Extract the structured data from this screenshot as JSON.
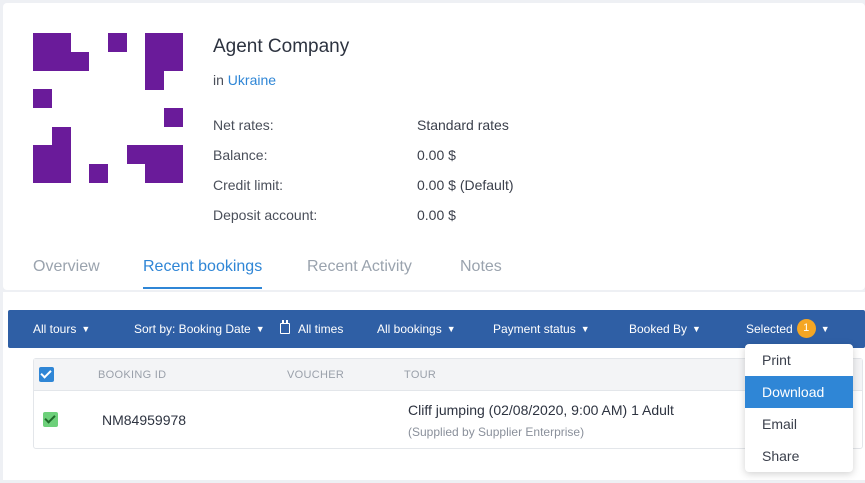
{
  "company": {
    "name": "Agent Company",
    "location_prefix": "in",
    "location": "Ukraine"
  },
  "info": [
    {
      "label": "Net rates:",
      "value": "Standard rates"
    },
    {
      "label": "Balance:",
      "value": "0.00 $"
    },
    {
      "label": "Credit limit:",
      "value": "0.00 $ (Default)"
    },
    {
      "label": "Deposit account:",
      "value": "0.00 $"
    }
  ],
  "tabs": [
    {
      "label": "Overview",
      "active": false
    },
    {
      "label": "Recent bookings",
      "active": true
    },
    {
      "label": "Recent Activity",
      "active": false
    },
    {
      "label": "Notes",
      "active": false
    }
  ],
  "toolbar": {
    "all_tours": "All tours",
    "sort_by": "Sort by: Booking Date",
    "all_times": "All times",
    "all_bookings": "All bookings",
    "payment_status": "Payment status",
    "booked_by": "Booked By",
    "selected": "Selected",
    "selected_count": "1"
  },
  "table": {
    "headers": {
      "booking_id": "BOOKING ID",
      "voucher": "VOUCHER",
      "tour": "TOUR"
    },
    "rows": [
      {
        "booking_id": "NM84959978",
        "voucher": "",
        "tour": "Cliff jumping (02/08/2020, 9:00 AM) 1 Adult",
        "supplier": "(Supplied by Supplier Enterprise)"
      }
    ]
  },
  "dropdown": {
    "items": [
      "Print",
      "Download",
      "Email",
      "Share"
    ],
    "highlighted": "Download"
  },
  "colors": {
    "brand_purple": "#6a1b9a",
    "accent_blue": "#2f86d6",
    "toolbar_blue": "#2f5fa5",
    "badge_orange": "#f5a623",
    "check_green": "#6dd07a"
  }
}
